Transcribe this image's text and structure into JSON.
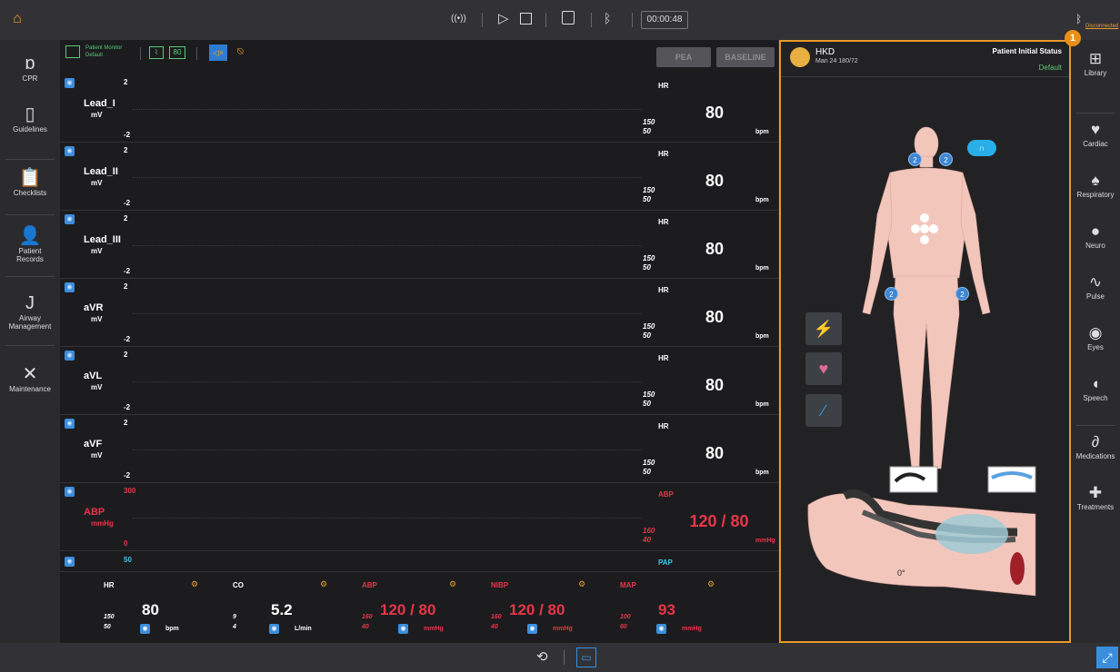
{
  "topbar": {
    "home_icon": "home-icon",
    "wireless_icon": "((•))",
    "play_icon": "play-icon",
    "stop_icon": "stop-icon",
    "save_icon": "save-icon",
    "bluetooth_icon": "bluetooth-icon",
    "timer": "00:00:48",
    "disconnected": "Disconnected",
    "callout": "1"
  },
  "left_nav": [
    {
      "label": "CPR",
      "icon": "cpr-icon"
    },
    {
      "label": "Guidelines",
      "icon": "guidelines-icon"
    },
    {
      "label": "Checklists",
      "icon": "checklists-icon"
    },
    {
      "label": "Patient Records",
      "icon": "patient-records-icon"
    },
    {
      "label": "Airway Management",
      "icon": "airway-icon"
    },
    {
      "label": "Maintenance",
      "icon": "maintenance-icon"
    }
  ],
  "right_nav": [
    {
      "label": "Library",
      "icon": "library-icon"
    },
    {
      "label": "Cardiac",
      "icon": "heart-icon"
    },
    {
      "label": "Respiratory",
      "icon": "lungs-icon"
    },
    {
      "label": "Neuro",
      "icon": "brain-icon"
    },
    {
      "label": "Pulse",
      "icon": "pulse-icon"
    },
    {
      "label": "Eyes",
      "icon": "eye-icon"
    },
    {
      "label": "Speech",
      "icon": "speech-icon"
    },
    {
      "label": "Medications",
      "icon": "medications-icon"
    },
    {
      "label": "Treatments",
      "icon": "treatments-icon"
    }
  ],
  "monitor_toolbar": {
    "layout_title": "Patient Monitor",
    "layout_subtitle": "Default",
    "numeric_badge": "80",
    "pea_button": "PEA",
    "baseline_button": "BASELINE"
  },
  "waveforms": [
    {
      "name": "Lead_I",
      "unit": "mV",
      "max": "2",
      "min": "-2",
      "param": "HR",
      "hi": "150",
      "lo": "50",
      "value": "80",
      "param_unit": "bpm",
      "color": "white"
    },
    {
      "name": "Lead_II",
      "unit": "mV",
      "max": "2",
      "min": "-2",
      "param": "HR",
      "hi": "150",
      "lo": "50",
      "value": "80",
      "param_unit": "bpm",
      "color": "white"
    },
    {
      "name": "Lead_III",
      "unit": "mV",
      "max": "2",
      "min": "-2",
      "param": "HR",
      "hi": "150",
      "lo": "50",
      "value": "80",
      "param_unit": "bpm",
      "color": "white"
    },
    {
      "name": "aVR",
      "unit": "mV",
      "max": "2",
      "min": "-2",
      "param": "HR",
      "hi": "150",
      "lo": "50",
      "value": "80",
      "param_unit": "bpm",
      "color": "white"
    },
    {
      "name": "aVL",
      "unit": "mV",
      "max": "2",
      "min": "-2",
      "param": "HR",
      "hi": "150",
      "lo": "50",
      "value": "80",
      "param_unit": "bpm",
      "color": "white"
    },
    {
      "name": "aVF",
      "unit": "mV",
      "max": "2",
      "min": "-2",
      "param": "HR",
      "hi": "150",
      "lo": "50",
      "value": "80",
      "param_unit": "bpm",
      "color": "white"
    },
    {
      "name": "ABP",
      "unit": "mmHg",
      "max": "300",
      "min": "0",
      "param": "ABP",
      "hi": "160",
      "lo": "40",
      "value": "120 / 80",
      "param_unit": "mmHg",
      "color": "red"
    }
  ],
  "pap": {
    "max": "50",
    "label": "PAP"
  },
  "bottom_params": [
    {
      "label": "HR",
      "value": "80",
      "hi": "150",
      "lo": "50",
      "unit": "bpm",
      "color": "white"
    },
    {
      "label": "CO",
      "value": "5.2",
      "hi": "9",
      "lo": "4",
      "unit": "L/min",
      "color": "white"
    },
    {
      "label": "ABP",
      "value": "120 / 80",
      "hi": "160",
      "lo": "40",
      "unit": "mmHg",
      "color": "red"
    },
    {
      "label": "NIBP",
      "value": "120 / 80",
      "hi": "160",
      "lo": "40",
      "unit": "mmHg",
      "color": "red"
    },
    {
      "label": "MAP",
      "value": "93",
      "hi": "100",
      "lo": "60",
      "unit": "mmHg",
      "color": "red"
    }
  ],
  "patient": {
    "name": "HKD",
    "details": "Man 24 180/72",
    "status_title": "Patient Initial Status",
    "status_value": "Default",
    "badge": "2",
    "angle": "0°"
  },
  "colors": {
    "accent": "#e89a2a",
    "blue": "#3b8ede",
    "red": "#e8354a",
    "green": "#5cc87a",
    "cyan": "#39c8e6"
  }
}
